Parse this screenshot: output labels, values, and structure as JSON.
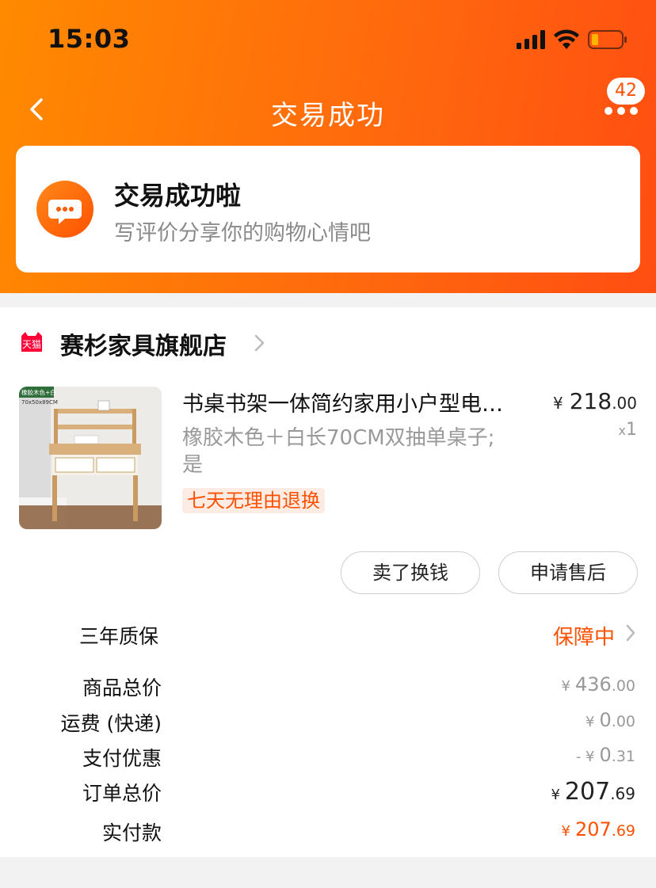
{
  "status_bar": {
    "time": "15:03"
  },
  "nav": {
    "title": "交易成功",
    "badge": "42"
  },
  "success_card": {
    "title": "交易成功啦",
    "subtitle": "写评价分享你的购物心情吧"
  },
  "shop": {
    "badge_text": "天猫",
    "name": "赛杉家具旗舰店"
  },
  "product": {
    "title": "书桌书架一体简约家用小户型电…",
    "spec_line1": "橡胶木色＋白长70CM双抽单桌子;",
    "spec_line2": "是",
    "tag": "七天无理由退换",
    "price_symbol": "¥",
    "price_int": "218",
    "price_dec": ".00",
    "qty_x": "x",
    "qty": "1",
    "image_caption1": "橡胶木色+白",
    "image_caption2": "70x50x89CM"
  },
  "actions": {
    "sell": "卖了换钱",
    "after_sale": "申请售后"
  },
  "warranty": {
    "label": "三年质保",
    "value": "保障中"
  },
  "summary": {
    "goods_total_label": "商品总价",
    "goods_total_sym": "¥",
    "goods_total_int": "436",
    "goods_total_dec": ".00",
    "shipping_label": "运费 (快递)",
    "shipping_sym": "¥",
    "shipping_int": "0",
    "shipping_dec": ".00",
    "discount_label": "支付优惠",
    "discount_sym": "- ¥",
    "discount_int": "0",
    "discount_dec": ".31",
    "order_total_label": "订单总价",
    "order_total_sym": "¥",
    "order_total_int": "207",
    "order_total_dec": ".69",
    "paid_label": "实付款",
    "paid_sym": "¥",
    "paid_int": "207",
    "paid_dec": ".69"
  },
  "colors": {
    "accent": "#ff5000",
    "header_start": "#ff8a00",
    "header_end": "#ff4e12"
  },
  "icons": [
    "signal-icon",
    "wifi-icon",
    "battery-icon",
    "back-icon",
    "more-icon",
    "chat-bubble-icon",
    "tmall-icon",
    "chevron-right-icon"
  ]
}
